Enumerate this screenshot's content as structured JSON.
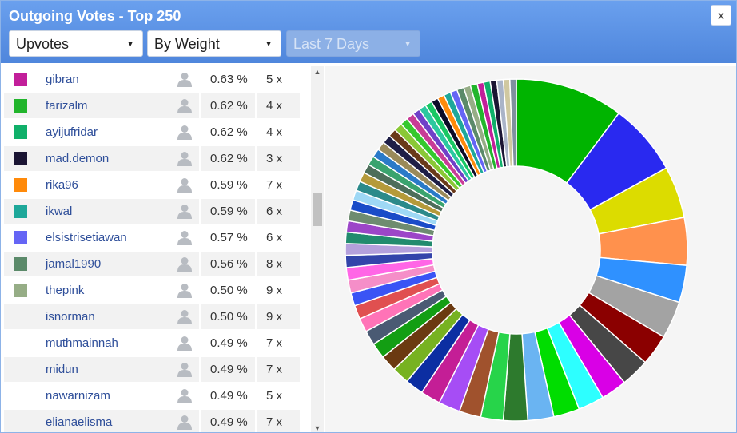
{
  "window": {
    "title": "Outgoing Votes - Top 250",
    "close_label": "x"
  },
  "filters": {
    "type": {
      "value": "Upvotes"
    },
    "sort": {
      "value": "By Weight"
    },
    "period": {
      "value": "Last 7 Days",
      "disabled": true
    }
  },
  "rows": [
    {
      "name": "gibran",
      "pct": "0.63 %",
      "count": "5 x",
      "color": "#c21f9a"
    },
    {
      "name": "farizalm",
      "pct": "0.62 %",
      "count": "4 x",
      "color": "#22b52c"
    },
    {
      "name": "ayijufridar",
      "pct": "0.62 %",
      "count": "4 x",
      "color": "#10b06a"
    },
    {
      "name": "mad.demon",
      "pct": "0.62 %",
      "count": "3 x",
      "color": "#1b1533"
    },
    {
      "name": "rika96",
      "pct": "0.59 %",
      "count": "7 x",
      "color": "#ff8a0a"
    },
    {
      "name": "ikwal",
      "pct": "0.59 %",
      "count": "6 x",
      "color": "#1ea89a"
    },
    {
      "name": "elsistrisetiawan",
      "pct": "0.57 %",
      "count": "6 x",
      "color": "#6565f5"
    },
    {
      "name": "jamal1990",
      "pct": "0.56 %",
      "count": "8 x",
      "color": "#5b8a6a"
    },
    {
      "name": "thepink",
      "pct": "0.50 %",
      "count": "9 x",
      "color": "#96ad86"
    },
    {
      "name": "isnorman",
      "pct": "0.50 %",
      "count": "9 x",
      "color": ""
    },
    {
      "name": "muthmainnah",
      "pct": "0.49 %",
      "count": "7 x",
      "color": ""
    },
    {
      "name": "midun",
      "pct": "0.49 %",
      "count": "7 x",
      "color": ""
    },
    {
      "name": "nawarnizam",
      "pct": "0.49 %",
      "count": "5 x",
      "color": ""
    },
    {
      "name": "elianaelisma",
      "pct": "0.49 %",
      "count": "7 x",
      "color": ""
    }
  ],
  "icons": {
    "avatar": "user-avatar-icon",
    "scroll_up": "chevron-up-icon",
    "scroll_down": "chevron-down-icon",
    "dropdown": "caret-down-icon"
  },
  "chart_data": {
    "type": "pie",
    "variant": "donut",
    "values": [
      12.5,
      8.3,
      6.0,
      5.5,
      4.3,
      4.3,
      3.6,
      3.3,
      3.0,
      3.0,
      3.0,
      3.0,
      2.8,
      2.6,
      2.5,
      2.5,
      2.3,
      2.1,
      2.0,
      1.9,
      1.8,
      1.7,
      1.6,
      1.6,
      1.5,
      1.5,
      1.45,
      1.4,
      1.35,
      1.3,
      1.3,
      1.25,
      1.2,
      1.15,
      1.1,
      1.1,
      1.05,
      1.05,
      1.0,
      1.0,
      1.0,
      0.95,
      0.95,
      0.9,
      0.9,
      0.85,
      0.85,
      0.8,
      0.8,
      0.8,
      0.8,
      0.8,
      0.8,
      0.8,
      0.8,
      0.75,
      0.75,
      0.75,
      0.75,
      0.75,
      0.75
    ],
    "colors": [
      "#00b400",
      "#2929f0",
      "#dcdc00",
      "#ff914d",
      "#2f91ff",
      "#a3a3a3",
      "#8b0000",
      "#474747",
      "#d900e6",
      "#2dffff",
      "#00dd00",
      "#6ab4f2",
      "#2d7a2d",
      "#27d44a",
      "#a0522d",
      "#a64df5",
      "#c41e96",
      "#0c2ea2",
      "#77b221",
      "#6b3a11",
      "#139e13",
      "#4a5a73",
      "#ff73b7",
      "#e05050",
      "#3a54f5",
      "#f58ec8",
      "#ff66e6",
      "#3344aa",
      "#b4a0dc",
      "#228b6e",
      "#9c46c8",
      "#6e8c70",
      "#1a4cc8",
      "#9ed8f5",
      "#2b8a8a",
      "#b59a3a",
      "#4d6e5a",
      "#3aa36e",
      "#2a7ac8",
      "#9a8a5a",
      "#1e1e46",
      "#6a3a1a",
      "#8ac836",
      "#35c82e",
      "#c83c96",
      "#7040c8",
      "#2cc8a0",
      "#19c864",
      "#0c0c28",
      "#ff8a0a",
      "#1ea89a",
      "#6565f5",
      "#5b8a6a",
      "#96ad86",
      "#22b52c",
      "#c21f9a",
      "#10b06a",
      "#1b1533",
      "#aab4c8",
      "#d0c8a0",
      "#8090a0"
    ]
  }
}
